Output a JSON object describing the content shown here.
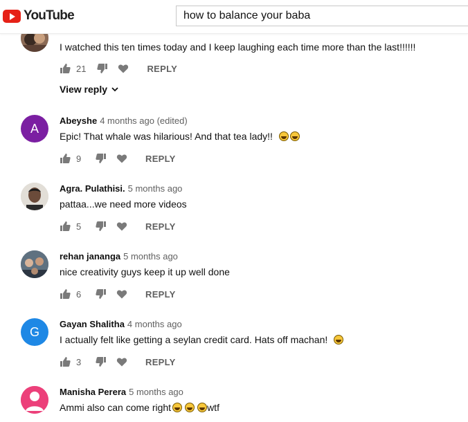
{
  "header": {
    "logo_text": "YouTube",
    "search_value": "how to balance your baba"
  },
  "comments": [
    {
      "text": "I watched this ten times today and I keep laughing each time more than the last!!!!!!",
      "likes": "21",
      "reply_label": "REPLY",
      "view_reply_label": "View reply"
    },
    {
      "author": "Abeyshe",
      "time": "4 months ago (edited)",
      "avatar_letter": "A",
      "avatar_color": "#7b1fa2",
      "text": "Epic! That whale was hilarious! And that tea lady!!",
      "likes": "9",
      "reply_label": "REPLY"
    },
    {
      "author": "Agra. Pulathisi.",
      "time": "5 months ago",
      "text": "pattaa...we need more videos",
      "likes": "5",
      "reply_label": "REPLY"
    },
    {
      "author": "rehan jananga",
      "time": "5 months ago",
      "text": "nice creativity guys keep it up well done",
      "likes": "6",
      "reply_label": "REPLY"
    },
    {
      "author": "Gayan Shalitha",
      "time": "4 months ago",
      "avatar_letter": "G",
      "avatar_color": "#1e88e5",
      "text": "I actually felt like getting a seylan credit card. Hats off machan!",
      "likes": "3",
      "reply_label": "REPLY"
    },
    {
      "author": "Manisha Perera",
      "time": "5 months ago",
      "avatar_color": "#ec407a",
      "text_before": "Ammi also can come right",
      "text_after": "wtf"
    }
  ]
}
